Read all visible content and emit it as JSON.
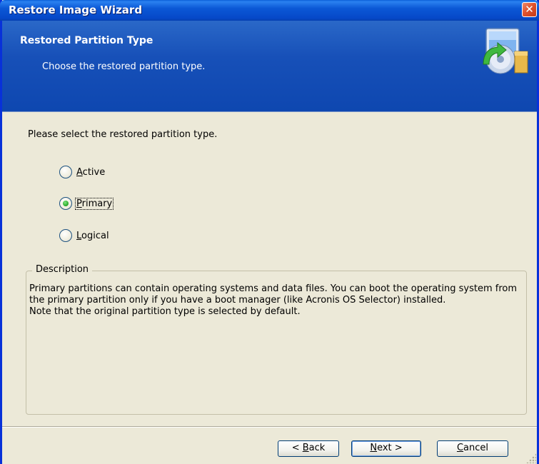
{
  "window": {
    "title": "Restore Image Wizard",
    "close_glyph": "✕"
  },
  "header": {
    "title": "Restored Partition Type",
    "subtitle": "Choose the restored partition type.",
    "icon": "restore-image-icon"
  },
  "content": {
    "prompt": "Please select the restored partition type.",
    "options": [
      {
        "mnemonic": "A",
        "rest": "ctive",
        "label": "Active",
        "checked": false
      },
      {
        "mnemonic": "P",
        "rest": "rimary",
        "label": "Primary",
        "checked": true
      },
      {
        "mnemonic": "L",
        "rest": "ogical",
        "label": "Logical",
        "checked": false
      }
    ]
  },
  "description": {
    "legend": "Description",
    "lines": [
      "Primary partitions can contain operating systems and data files. You can boot the operating system from the primary partition only if you have a boot manager (like Acronis OS Selector) installed.",
      "Note that the original partition type is selected by default."
    ]
  },
  "buttons": {
    "back": {
      "pre": "< ",
      "mnemonic": "B",
      "rest": "ack"
    },
    "next": {
      "pre": "",
      "mnemonic": "N",
      "rest": "ext >"
    },
    "cancel": {
      "pre": "",
      "mnemonic": "C",
      "rest": "ancel"
    }
  },
  "colors": {
    "titlebar": "#0b58d6",
    "header": "#1750b8",
    "dialog_bg": "#ece9d8",
    "radio_check": "#2fae2f",
    "close_button": "#e0532e"
  }
}
